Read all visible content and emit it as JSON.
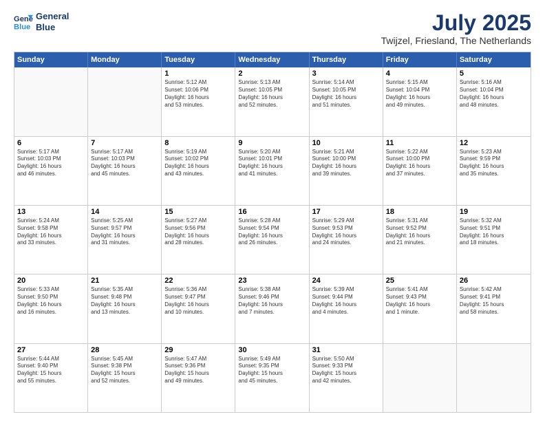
{
  "header": {
    "logo_line1": "General",
    "logo_line2": "Blue",
    "title": "July 2025",
    "location": "Twijzel, Friesland, The Netherlands"
  },
  "calendar": {
    "days_of_week": [
      "Sunday",
      "Monday",
      "Tuesday",
      "Wednesday",
      "Thursday",
      "Friday",
      "Saturday"
    ],
    "weeks": [
      [
        {
          "day": "",
          "text": ""
        },
        {
          "day": "",
          "text": ""
        },
        {
          "day": "1",
          "text": "Sunrise: 5:12 AM\nSunset: 10:06 PM\nDaylight: 16 hours\nand 53 minutes."
        },
        {
          "day": "2",
          "text": "Sunrise: 5:13 AM\nSunset: 10:05 PM\nDaylight: 16 hours\nand 52 minutes."
        },
        {
          "day": "3",
          "text": "Sunrise: 5:14 AM\nSunset: 10:05 PM\nDaylight: 16 hours\nand 51 minutes."
        },
        {
          "day": "4",
          "text": "Sunrise: 5:15 AM\nSunset: 10:04 PM\nDaylight: 16 hours\nand 49 minutes."
        },
        {
          "day": "5",
          "text": "Sunrise: 5:16 AM\nSunset: 10:04 PM\nDaylight: 16 hours\nand 48 minutes."
        }
      ],
      [
        {
          "day": "6",
          "text": "Sunrise: 5:17 AM\nSunset: 10:03 PM\nDaylight: 16 hours\nand 46 minutes."
        },
        {
          "day": "7",
          "text": "Sunrise: 5:17 AM\nSunset: 10:03 PM\nDaylight: 16 hours\nand 45 minutes."
        },
        {
          "day": "8",
          "text": "Sunrise: 5:19 AM\nSunset: 10:02 PM\nDaylight: 16 hours\nand 43 minutes."
        },
        {
          "day": "9",
          "text": "Sunrise: 5:20 AM\nSunset: 10:01 PM\nDaylight: 16 hours\nand 41 minutes."
        },
        {
          "day": "10",
          "text": "Sunrise: 5:21 AM\nSunset: 10:00 PM\nDaylight: 16 hours\nand 39 minutes."
        },
        {
          "day": "11",
          "text": "Sunrise: 5:22 AM\nSunset: 10:00 PM\nDaylight: 16 hours\nand 37 minutes."
        },
        {
          "day": "12",
          "text": "Sunrise: 5:23 AM\nSunset: 9:59 PM\nDaylight: 16 hours\nand 35 minutes."
        }
      ],
      [
        {
          "day": "13",
          "text": "Sunrise: 5:24 AM\nSunset: 9:58 PM\nDaylight: 16 hours\nand 33 minutes."
        },
        {
          "day": "14",
          "text": "Sunrise: 5:25 AM\nSunset: 9:57 PM\nDaylight: 16 hours\nand 31 minutes."
        },
        {
          "day": "15",
          "text": "Sunrise: 5:27 AM\nSunset: 9:56 PM\nDaylight: 16 hours\nand 28 minutes."
        },
        {
          "day": "16",
          "text": "Sunrise: 5:28 AM\nSunset: 9:54 PM\nDaylight: 16 hours\nand 26 minutes."
        },
        {
          "day": "17",
          "text": "Sunrise: 5:29 AM\nSunset: 9:53 PM\nDaylight: 16 hours\nand 24 minutes."
        },
        {
          "day": "18",
          "text": "Sunrise: 5:31 AM\nSunset: 9:52 PM\nDaylight: 16 hours\nand 21 minutes."
        },
        {
          "day": "19",
          "text": "Sunrise: 5:32 AM\nSunset: 9:51 PM\nDaylight: 16 hours\nand 18 minutes."
        }
      ],
      [
        {
          "day": "20",
          "text": "Sunrise: 5:33 AM\nSunset: 9:50 PM\nDaylight: 16 hours\nand 16 minutes."
        },
        {
          "day": "21",
          "text": "Sunrise: 5:35 AM\nSunset: 9:48 PM\nDaylight: 16 hours\nand 13 minutes."
        },
        {
          "day": "22",
          "text": "Sunrise: 5:36 AM\nSunset: 9:47 PM\nDaylight: 16 hours\nand 10 minutes."
        },
        {
          "day": "23",
          "text": "Sunrise: 5:38 AM\nSunset: 9:46 PM\nDaylight: 16 hours\nand 7 minutes."
        },
        {
          "day": "24",
          "text": "Sunrise: 5:39 AM\nSunset: 9:44 PM\nDaylight: 16 hours\nand 4 minutes."
        },
        {
          "day": "25",
          "text": "Sunrise: 5:41 AM\nSunset: 9:43 PM\nDaylight: 16 hours\nand 1 minute."
        },
        {
          "day": "26",
          "text": "Sunrise: 5:42 AM\nSunset: 9:41 PM\nDaylight: 15 hours\nand 58 minutes."
        }
      ],
      [
        {
          "day": "27",
          "text": "Sunrise: 5:44 AM\nSunset: 9:40 PM\nDaylight: 15 hours\nand 55 minutes."
        },
        {
          "day": "28",
          "text": "Sunrise: 5:45 AM\nSunset: 9:38 PM\nDaylight: 15 hours\nand 52 minutes."
        },
        {
          "day": "29",
          "text": "Sunrise: 5:47 AM\nSunset: 9:36 PM\nDaylight: 15 hours\nand 49 minutes."
        },
        {
          "day": "30",
          "text": "Sunrise: 5:49 AM\nSunset: 9:35 PM\nDaylight: 15 hours\nand 45 minutes."
        },
        {
          "day": "31",
          "text": "Sunrise: 5:50 AM\nSunset: 9:33 PM\nDaylight: 15 hours\nand 42 minutes."
        },
        {
          "day": "",
          "text": ""
        },
        {
          "day": "",
          "text": ""
        }
      ]
    ]
  }
}
